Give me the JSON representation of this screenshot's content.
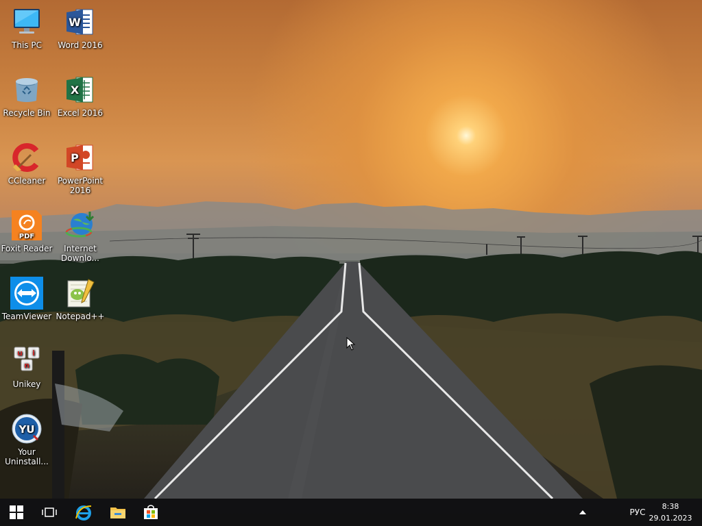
{
  "desktop": {
    "icons": [
      {
        "label": "This PC",
        "icon": "this-pc-icon"
      },
      {
        "label": "Word 2016",
        "icon": "word-icon"
      },
      {
        "label": "Recycle Bin",
        "icon": "recycle-bin-icon"
      },
      {
        "label": "Excel 2016",
        "icon": "excel-icon"
      },
      {
        "label": "CCleaner",
        "icon": "ccleaner-icon"
      },
      {
        "label": "PowerPoint 2016",
        "icon": "powerpoint-icon"
      },
      {
        "label": "Foxit Reader",
        "icon": "foxit-reader-icon"
      },
      {
        "label": "Internet Downlo...",
        "icon": "internet-download-manager-icon"
      },
      {
        "label": "TeamViewer",
        "icon": "teamviewer-icon"
      },
      {
        "label": "Notepad++",
        "icon": "notepad-plus-plus-icon"
      },
      {
        "label": "Unikey",
        "icon": "unikey-icon"
      },
      {
        "label": "Your Uninstall...",
        "icon": "your-uninstaller-icon"
      }
    ]
  },
  "taskbar": {
    "pinned": [
      {
        "name": "start",
        "icon": "windows-logo-icon"
      },
      {
        "name": "task-view",
        "icon": "task-view-icon"
      },
      {
        "name": "internet-explorer",
        "icon": "internet-explorer-icon"
      },
      {
        "name": "file-explorer",
        "icon": "folder-icon"
      },
      {
        "name": "store",
        "icon": "store-icon"
      }
    ],
    "tray": {
      "language": "РУС",
      "time": "8:38",
      "date": "29.01.2023"
    }
  },
  "colors": {
    "taskbar": "#101012",
    "word": "#2b579a",
    "excel": "#217346",
    "powerpoint": "#d24726",
    "foxit": "#f58220",
    "teamviewer": "#0e8ee9"
  }
}
